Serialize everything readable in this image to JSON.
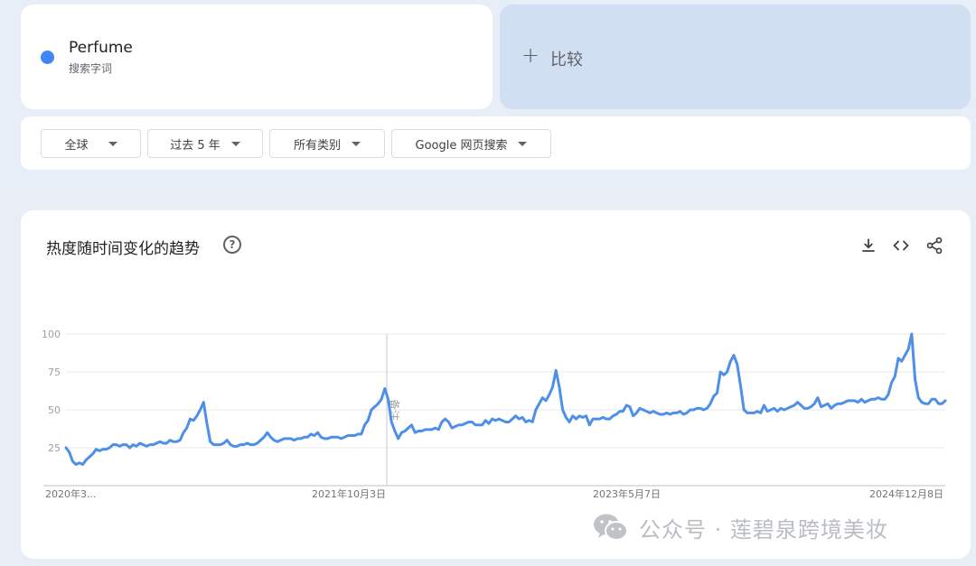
{
  "search_term": {
    "name": "Perfume",
    "type": "搜索字词",
    "color": "#4285f4"
  },
  "compare": {
    "label": "比较",
    "icon": "plus-icon"
  },
  "filters": [
    {
      "label": "全球"
    },
    {
      "label": "过去 5 年"
    },
    {
      "label": "所有类别"
    },
    {
      "label": "Google 网页搜索"
    }
  ],
  "chart_panel": {
    "title": "热度随时间变化的趋势",
    "help_icon": "question-mark-icon",
    "help_glyph": "?",
    "tools": [
      "download-icon",
      "embed-code-icon",
      "share-icon"
    ]
  },
  "chart_data": {
    "type": "line",
    "series": [
      {
        "color": "#4e8fe8",
        "values": [
          25,
          22,
          16,
          14,
          15,
          14,
          17,
          19,
          21,
          24,
          23,
          24,
          24,
          25,
          27,
          27,
          26,
          27,
          27,
          25,
          27,
          26,
          28,
          27,
          26,
          27,
          27,
          28,
          29,
          28,
          28,
          30,
          29,
          29,
          30,
          35,
          38,
          44,
          43,
          46,
          50,
          55,
          41,
          29,
          27,
          27,
          27,
          28,
          30,
          27,
          26,
          26,
          27,
          27,
          28,
          27,
          27,
          28,
          30,
          32,
          35,
          32,
          30,
          29,
          30,
          31,
          31,
          31,
          30,
          31,
          31,
          32,
          32,
          34,
          33,
          35,
          32,
          31,
          31,
          32,
          32,
          32,
          31,
          32,
          33,
          33,
          33,
          34,
          34,
          40,
          43,
          50,
          52,
          54,
          57,
          64,
          57,
          42,
          36,
          31,
          35,
          36,
          38,
          40,
          35,
          36,
          36,
          37,
          37,
          37,
          38,
          37,
          42,
          44,
          42,
          38,
          39,
          40,
          40,
          41,
          42,
          42,
          40,
          40,
          40,
          43,
          41,
          44,
          43,
          44,
          43,
          42,
          42,
          44,
          46,
          44,
          45,
          42,
          43,
          42,
          50,
          54,
          58,
          56,
          60,
          65,
          76,
          65,
          50,
          45,
          42,
          46,
          44,
          46,
          45,
          46,
          40,
          44,
          44,
          44,
          45,
          44,
          44,
          46,
          47,
          49,
          49,
          53,
          52,
          46,
          48,
          51,
          50,
          49,
          48,
          49,
          48,
          47,
          47,
          48,
          47,
          48,
          48,
          49,
          47,
          48,
          50,
          50,
          51,
          51,
          50,
          51,
          54,
          59,
          61,
          75,
          73,
          75,
          82,
          86,
          80,
          66,
          50,
          48,
          48,
          48,
          49,
          48,
          53,
          49,
          50,
          51,
          49,
          51,
          50,
          51,
          52,
          53,
          55,
          53,
          51,
          51,
          52,
          54,
          58,
          52,
          53,
          54,
          51,
          53,
          54,
          54,
          55,
          56,
          56,
          56,
          55,
          57,
          55,
          56,
          57,
          57,
          58,
          57,
          57,
          60,
          68,
          72,
          84,
          82,
          86,
          90,
          100,
          70,
          58,
          55,
          54,
          54,
          57,
          57,
          54,
          54,
          56
        ]
      }
    ],
    "x_tick_labels": [
      "2020年3...",
      "2021年10月3日",
      "2023年5月7日",
      "2024年12月8日"
    ],
    "y_ticks": [
      100,
      75,
      50,
      25
    ],
    "ylim": [
      0,
      100
    ],
    "grid": true,
    "annotation": "备注"
  },
  "watermark": {
    "icon": "wechat-icon",
    "text": "公众号 · 莲碧泉跨境美妆"
  }
}
